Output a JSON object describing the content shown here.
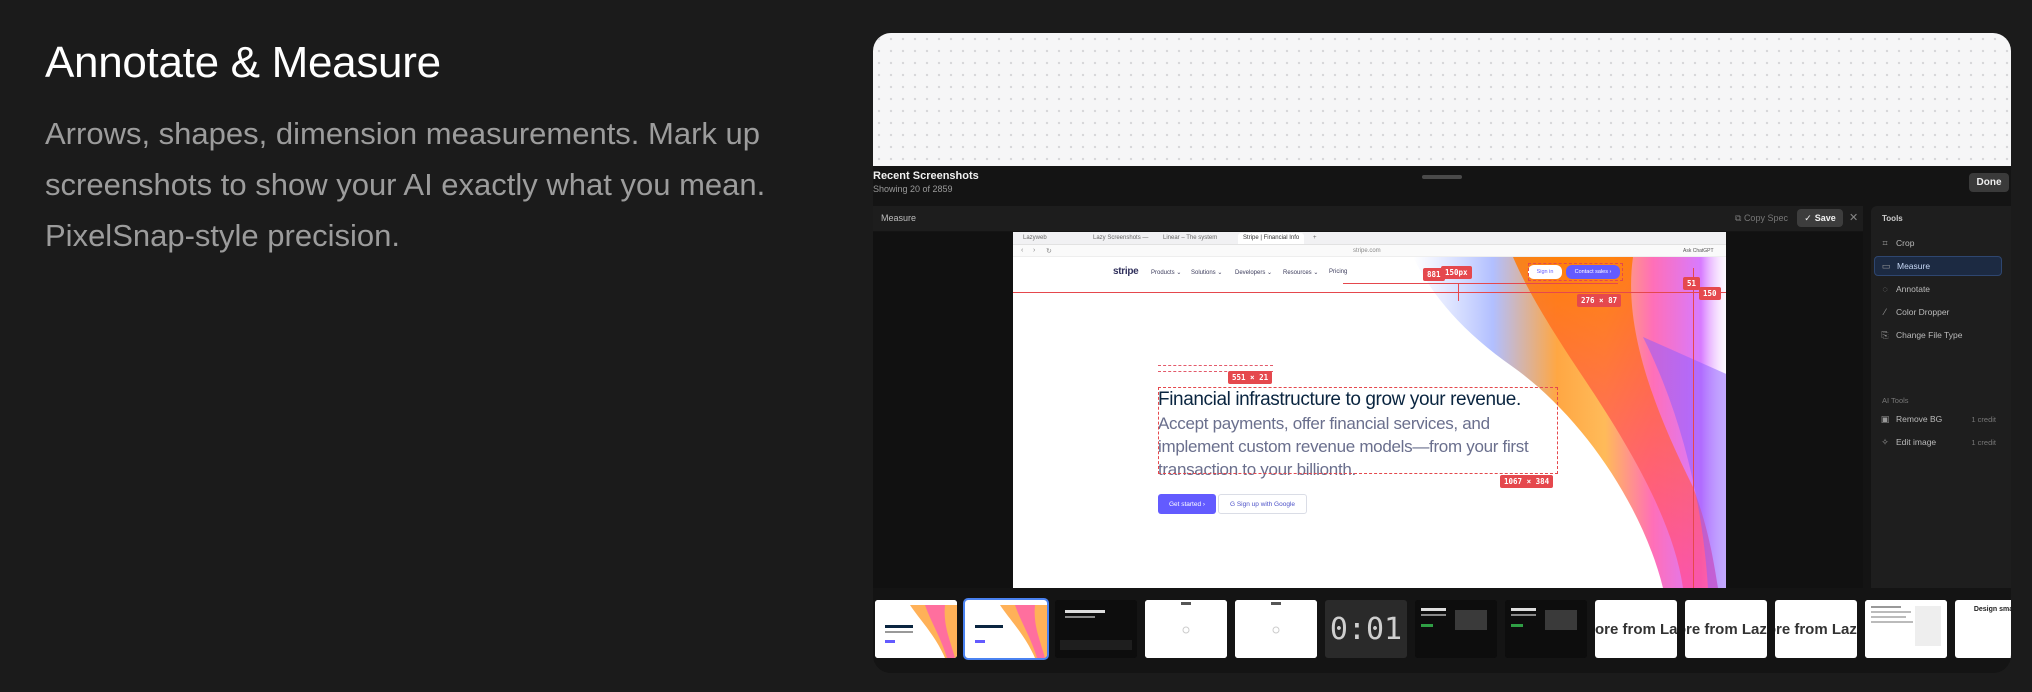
{
  "hero": {
    "title": "Annotate & Measure",
    "description": "Arrows, shapes, dimension measurements. Mark up screenshots to show your AI exactly what you mean. PixelSnap-style precision."
  },
  "panel": {
    "title": "Recent Screenshots",
    "subtitle": "Showing 20 of 2859",
    "done_label": "Done"
  },
  "measure_bar": {
    "label": "Measure",
    "copy_spec": "Copy Spec",
    "save_label": "Save"
  },
  "screenshot": {
    "tabs": [
      "Lazyweb",
      "Lazy Screenshots —",
      "Linear – The system",
      "Stripe | Financial Info"
    ],
    "url": "stripe.com",
    "ask_gpt": "Ask ChatGPT",
    "logo": "stripe",
    "nav": [
      "Products ⌄",
      "Solutions ⌄",
      "Developers ⌄",
      "Resources ⌄",
      "Pricing"
    ],
    "sign_in": "Sign in",
    "contact_sales": "Contact sales ›",
    "headline": "Financial infrastructure to grow your revenue.",
    "body": "Accept payments, offer financial services, and implement custom revenue models—from your first transaction to your billionth.",
    "get_started": "Get started ›",
    "google_signup": "Sign up with Google",
    "measurements": {
      "m1": "881",
      "m2": "150px",
      "m3": "276 × 87",
      "m4": "51",
      "m5": "150",
      "m6": "551 × 21",
      "m7": "1067 × 384"
    }
  },
  "tools": {
    "heading": "Tools",
    "items": [
      {
        "label": "Crop",
        "icon": "crop-icon"
      },
      {
        "label": "Measure",
        "icon": "ruler-icon"
      },
      {
        "label": "Annotate",
        "icon": "annotate-icon"
      },
      {
        "label": "Color Dropper",
        "icon": "dropper-icon"
      },
      {
        "label": "Change File Type",
        "icon": "file-type-icon"
      }
    ],
    "ai_heading": "AI Tools",
    "ai_items": [
      {
        "label": "Remove BG",
        "credit": "1 credit",
        "icon": "remove-bg-icon"
      },
      {
        "label": "Edit image",
        "credit": "1 credit",
        "icon": "sparkle-icon"
      }
    ]
  },
  "thumbnails": {
    "timer_text": "0:01",
    "more_text": "ore from Lazy",
    "design_text": "Design smart"
  },
  "colors": {
    "accent": "#635bff",
    "measure_red": "#e5484d",
    "selection_blue": "#4a82f0"
  }
}
